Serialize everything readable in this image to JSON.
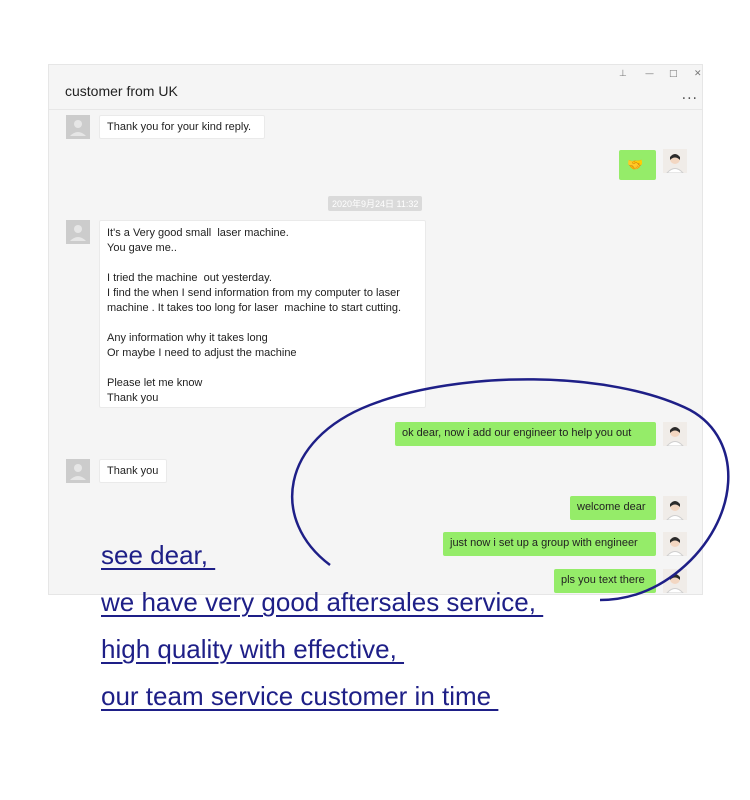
{
  "window": {
    "title": "customer from UK",
    "controls": [
      "pin-icon",
      "minimize-icon",
      "maximize-icon",
      "close-icon"
    ],
    "more_label": "..."
  },
  "chat": {
    "messages": [
      {
        "side": "in",
        "text": "Thank you for your kind reply."
      },
      {
        "side": "out",
        "text": "🤝"
      },
      {
        "side": "in",
        "lines": [
          "It's a Very good small  laser machine.",
          "You gave me..",
          "",
          "I tried the machine  out yesterday.",
          "I find the when I send information from my computer to laser",
          "machine . It takes too long for laser  machine to start cutting.",
          "",
          "Any information why it takes long",
          "Or maybe I need to adjust the machine",
          "",
          "Please let me know",
          "Thank you"
        ]
      },
      {
        "side": "out",
        "text": "ok dear, now i add our engineer to help you out"
      },
      {
        "side": "in",
        "text": "Thank you"
      },
      {
        "side": "out",
        "text": "welcome dear"
      },
      {
        "side": "out",
        "text": "just now i set up a group with engineer"
      },
      {
        "side": "out",
        "text": "pls you text there"
      }
    ],
    "timestamp": "2020年9月24日 11:32"
  },
  "overlay": {
    "lines": [
      "see dear, ",
      "we have very good aftersales service, ",
      "high quality with effective, ",
      "our team service customer in time "
    ]
  },
  "colors": {
    "accent_outgoing": "#95ec69",
    "overlay_text": "#1e1f87",
    "ellipse": "#1e1f87"
  }
}
